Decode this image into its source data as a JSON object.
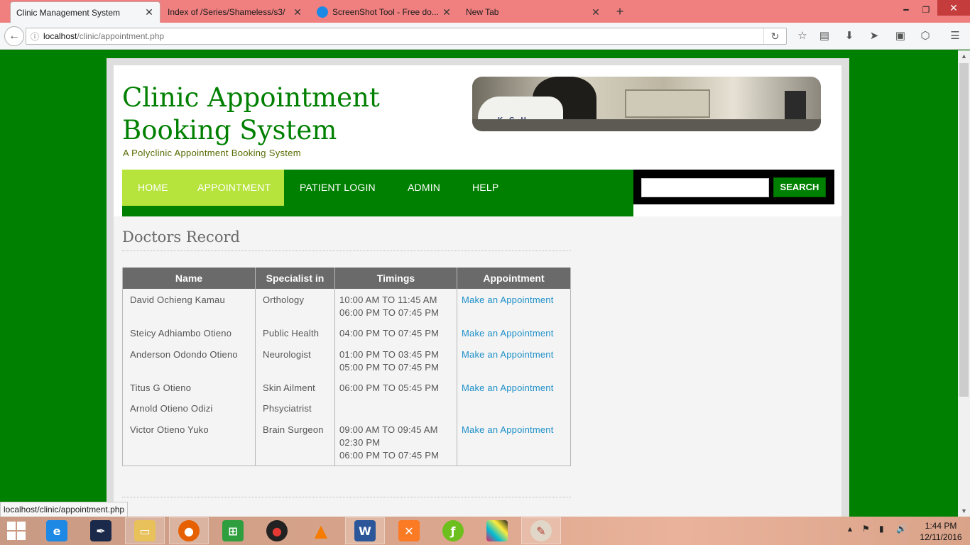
{
  "browser": {
    "tabs": [
      {
        "label": "Clinic Management System",
        "active": true
      },
      {
        "label": "Index of /Series/Shameless/s3/",
        "active": false
      },
      {
        "label": "ScreenShot Tool - Free do...",
        "active": false
      },
      {
        "label": "New Tab",
        "active": false
      }
    ],
    "new_tab_symbol": "+",
    "url_host": "localhost",
    "url_path": "/clinic/appointment.php",
    "status_url": "localhost/clinic/appointment.php"
  },
  "site": {
    "title": "Clinic Appointment Booking System",
    "slogan": "A Polyclinic Appointment Booking System",
    "banner_text": "K.G.H",
    "menu": [
      "HOME",
      "APPOINTMENT",
      "PATIENT LOGIN",
      "ADMIN",
      "HELP"
    ],
    "search_button": "SEARCH",
    "search_value": ""
  },
  "content": {
    "heading": "Doctors Record",
    "columns": [
      "Name",
      "Specialist in",
      "Timings",
      "Appointment"
    ],
    "rows": [
      {
        "name": "David Ochieng Kamau",
        "specialist": "Orthology",
        "timings": [
          "10:00 AM TO 11:45 AM",
          "06:00 PM TO 07:45 PM"
        ],
        "appointment": "Make an Appointment"
      },
      {
        "name": "Steicy Adhiambo Otieno",
        "specialist": "Public Health",
        "timings": [
          "04:00 PM TO 07:45 PM"
        ],
        "appointment": "Make an Appointment"
      },
      {
        "name": "Anderson Odondo Otieno",
        "specialist": "Neurologist",
        "timings": [
          "01:00 PM TO 03:45 PM",
          "05:00 PM TO 07:45 PM"
        ],
        "appointment": "Make an Appointment"
      },
      {
        "name": "Titus G Otieno",
        "specialist": "Skin Ailment",
        "timings": [
          "06:00 PM TO 05:45 PM"
        ],
        "appointment": "Make an Appointment"
      },
      {
        "name": "Arnold Otieno Odizi",
        "specialist": "Phsyciatrist",
        "timings": [],
        "appointment": ""
      },
      {
        "name": "Victor Otieno Yuko",
        "specialist": "Brain Surgeon",
        "timings": [
          "09:00 AM TO 09:45 AM",
          "02:30 PM",
          "06:00 PM TO 07:45 PM"
        ],
        "appointment": "Make an Appointment"
      }
    ]
  },
  "taskbar": {
    "apps": [
      "internet-explorer",
      "feather-app",
      "file-explorer",
      "firefox",
      "store",
      "red-app",
      "vlc",
      "word",
      "xampp",
      "dreamweaver",
      "pixel-app",
      "paint"
    ],
    "time": "1:44 PM",
    "date": "12/11/2016"
  },
  "colors": {
    "page_bg": "#008000",
    "menu_bg": "#008000",
    "menu_highlight": "#b6e33c",
    "link": "#1e90c8",
    "tab_strip": "#f08080"
  }
}
